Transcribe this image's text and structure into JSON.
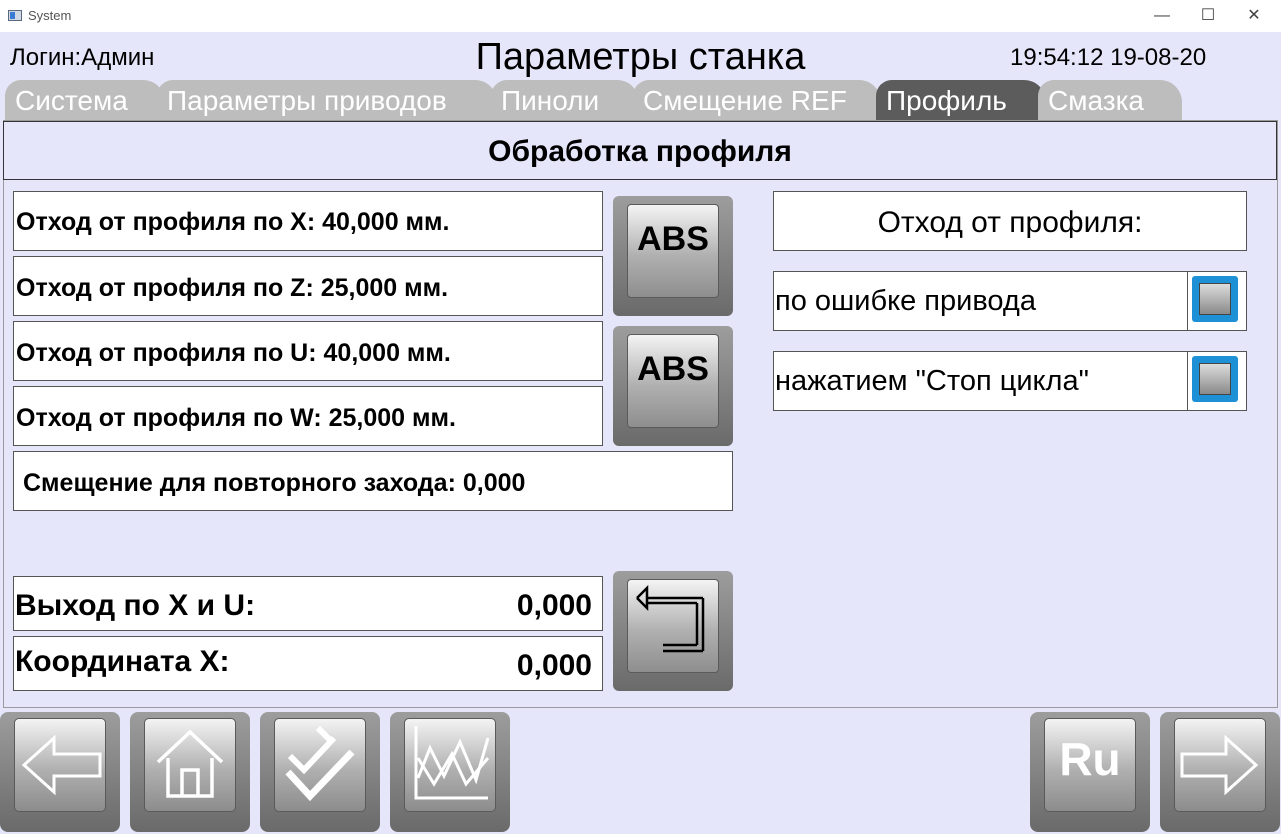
{
  "window": {
    "title": "System",
    "minimize": "—",
    "maximize": "☐",
    "close": "✕"
  },
  "header": {
    "login": "Логин:Админ",
    "title": "Параметры станка",
    "datetime": "19:54:12 19-08-20"
  },
  "tabs": [
    {
      "label": "Система"
    },
    {
      "label": "Параметры приводов"
    },
    {
      "label": "Пиноли"
    },
    {
      "label": "Смещение REF"
    },
    {
      "label": "Профиль"
    },
    {
      "label": "Смазка"
    }
  ],
  "active_tab": "Профиль",
  "section": {
    "title": "Обработка профиля"
  },
  "params": {
    "x": "Отход от профиля по X: 40,000 мм.",
    "z": "Отход от профиля по Z: 25,000 мм.",
    "u": "Отход от профиля по U: 40,000 мм.",
    "w": "Отход от профиля по W: 25,000 мм.",
    "offset": "Смещение для повторного захода: 0,000"
  },
  "abs_buttons": {
    "label1": "ABS",
    "label2": "ABS"
  },
  "exit": {
    "xu_label": "Выход по X и U:",
    "xu_value": "0,000",
    "coordx_label": "Координата X:",
    "coordx_value": "0,000"
  },
  "retract": {
    "title": "Отход от профиля:",
    "option1": {
      "label": "по ошибке привода",
      "checked": false
    },
    "option2": {
      "label": "нажатием \"Стоп цикла\"",
      "checked": false
    }
  },
  "nav": {
    "back_icon": "arrow-left-icon",
    "home_icon": "home-icon",
    "save_icon": "check-pen-icon",
    "chart_icon": "chart-icon",
    "lang_label": "Ru",
    "forward_icon": "arrow-right-icon"
  },
  "colors": {
    "active_tab": "#5c5c5c",
    "inactive_tab": "#bdbdbd",
    "background": "#e6e6fa",
    "checkbox": "#1e90d6"
  }
}
